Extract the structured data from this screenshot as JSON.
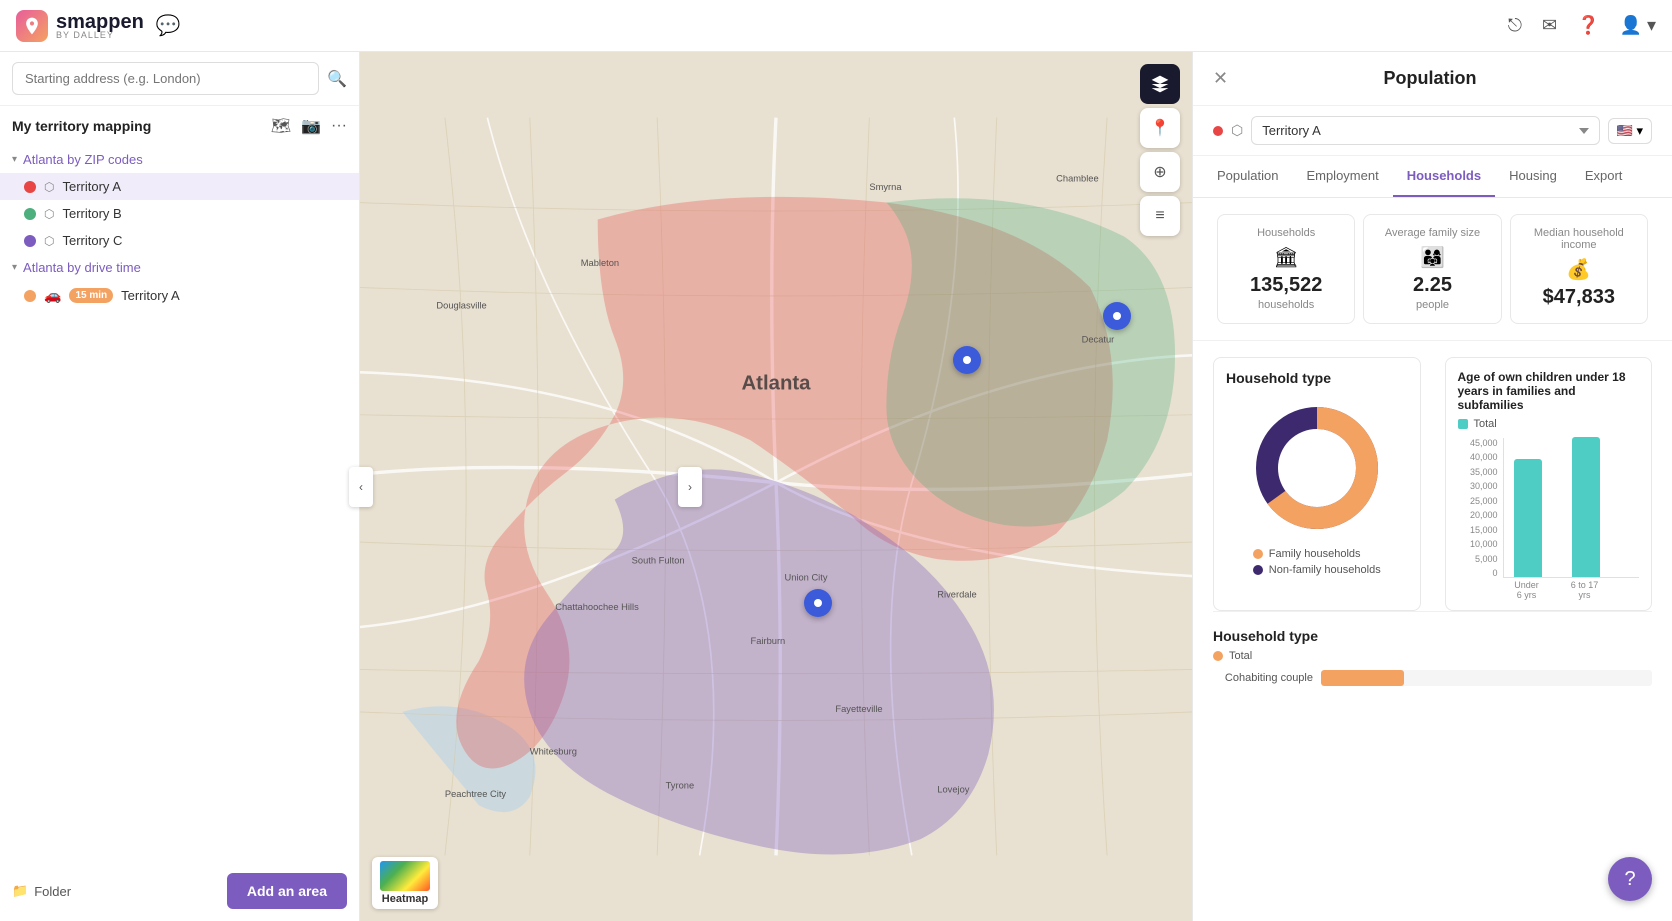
{
  "header": {
    "logo_text": "smappen",
    "logo_sub": "by DALLEY",
    "chat_placeholder": "💬"
  },
  "sidebar": {
    "title": "My territory mapping",
    "search_placeholder": "Starting address (e.g. London)",
    "groups": [
      {
        "id": "zip",
        "label": "Atlanta by ZIP codes",
        "territories": [
          {
            "id": "a",
            "name": "Territory A",
            "color": "red",
            "active": true
          },
          {
            "id": "b",
            "name": "Territory B",
            "color": "green",
            "active": false
          },
          {
            "id": "c",
            "name": "Territory C",
            "color": "purple",
            "active": false
          }
        ]
      },
      {
        "id": "drive",
        "label": "Atlanta by drive time",
        "territories": [
          {
            "id": "da",
            "name": "Territory A",
            "badge": "15 min",
            "color": "orange",
            "active": false
          }
        ]
      }
    ],
    "folder_label": "Folder",
    "add_area_label": "Add an area"
  },
  "map": {
    "heatmap_label": "Heatmap"
  },
  "right_panel": {
    "title": "Population",
    "territory_name": "Territory A",
    "tabs": [
      "Population",
      "Employment",
      "Households",
      "Housing",
      "Export"
    ],
    "active_tab": "Households",
    "stats": [
      {
        "label": "Households",
        "value": "135,522",
        "sub": "households",
        "icon": "🏛"
      },
      {
        "label": "Average family size",
        "value": "2.25",
        "sub": "people",
        "icon": "👨‍👩‍👧"
      },
      {
        "label": "Median household income",
        "value": "$47,833",
        "sub": "",
        "icon": "💰"
      }
    ],
    "household_type_chart": {
      "title": "Household type",
      "donut": {
        "family_pct": 65,
        "non_family_pct": 35,
        "family_color": "#f4a261",
        "non_family_color": "#3d2a6e"
      },
      "legend": [
        {
          "label": "Family households",
          "color": "#f4a261"
        },
        {
          "label": "Non-family households",
          "color": "#3d2a6e"
        }
      ]
    },
    "age_children_chart": {
      "title": "Age of own children under 18 years in families and subfamilies",
      "legend_label": "Total",
      "legend_color": "#4ecdc4",
      "bars": [
        {
          "label": "Under 6 yrs",
          "value": 38000,
          "max": 45000
        },
        {
          "label": "6 to 17 yrs",
          "value": 45000,
          "max": 45000
        }
      ],
      "y_axis": [
        "45,000",
        "40,000",
        "35,000",
        "30,000",
        "25,000",
        "20,000",
        "15,000",
        "10,000",
        "5,000",
        "0"
      ]
    },
    "household_type2": {
      "title": "Household type",
      "legend_label": "Total",
      "legend_color": "#f4a261",
      "rows": [
        {
          "label": "Cohabiting couple",
          "pct": 25
        }
      ]
    }
  }
}
